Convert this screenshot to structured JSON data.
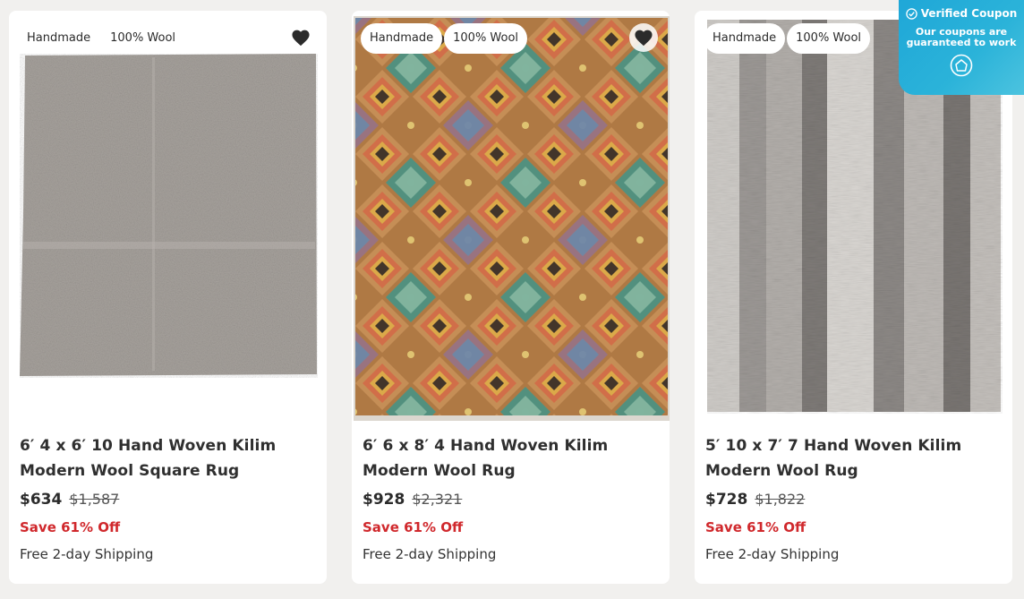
{
  "products": [
    {
      "tags": [
        "Handmade",
        "100% Wool"
      ],
      "title": "6′ 4 x 6′ 10 Hand Woven Kilim Modern Wool Square Rug",
      "price": "$634",
      "old_price": "$1,587",
      "save": "Save 61% Off",
      "shipping": "Free 2-day Shipping",
      "image": "grey-kilim-rug"
    },
    {
      "tags": [
        "Handmade",
        "100% Wool"
      ],
      "title": "6′ 6 x 8′ 4 Hand Woven Kilim Modern Wool Rug",
      "price": "$928",
      "old_price": "$2,321",
      "save": "Save 61% Off",
      "shipping": "Free 2-day Shipping",
      "image": "multicolor-diamond-kilim-rug"
    },
    {
      "tags": [
        "Handmade",
        "100% Wool"
      ],
      "title": "5′ 10 x 7′ 7 Hand Woven Kilim Modern Wool Rug",
      "price": "$728",
      "old_price": "$1,822",
      "save": "Save 61% Off",
      "shipping": "Free 2-day Shipping",
      "image": "grey-striped-kilim-rug"
    }
  ],
  "coupon": {
    "title": "Verified Coupon",
    "subtitle": "Our coupons are guaranteed to work",
    "icon": "coupon-badge-icon",
    "color": "#26aed9"
  },
  "colors": {
    "sale": "#d0282c",
    "background": "#f1f0ee"
  }
}
